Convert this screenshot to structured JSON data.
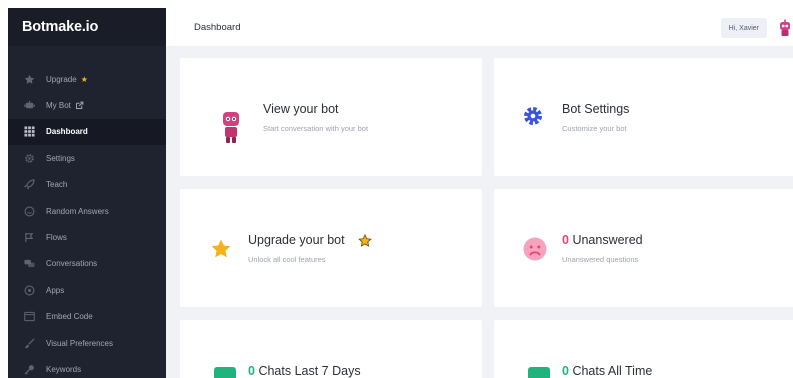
{
  "brand": {
    "name": "Botmake.io"
  },
  "sidebar": {
    "items": [
      {
        "label": "Upgrade",
        "icon": "star-icon"
      },
      {
        "label": "My Bot",
        "icon": "bot-icon"
      },
      {
        "label": "Dashboard",
        "icon": "grid-icon",
        "active": true
      },
      {
        "label": "Settings",
        "icon": "gear-icon"
      },
      {
        "label": "Teach",
        "icon": "rocket-icon"
      },
      {
        "label": "Random Answers",
        "icon": "smiley-icon"
      },
      {
        "label": "Flows",
        "icon": "flows-icon"
      },
      {
        "label": "Conversations",
        "icon": "chat-icon"
      },
      {
        "label": "Apps",
        "icon": "apps-icon"
      },
      {
        "label": "Embed Code",
        "icon": "code-icon"
      },
      {
        "label": "Visual Preferences",
        "icon": "brush-icon"
      },
      {
        "label": "Keywords",
        "icon": "key-icon"
      }
    ]
  },
  "topbar": {
    "title": "Dashboard",
    "greeting": "Hi, Xavier"
  },
  "cards": {
    "view_bot": {
      "title": "View your bot",
      "subtitle": "Start conversation with your bot"
    },
    "bot_settings": {
      "title": "Bot Settings",
      "subtitle": "Customize your bot"
    },
    "upgrade": {
      "title": "Upgrade your bot",
      "subtitle": "Unlock all cool features"
    },
    "unanswered": {
      "count": "0",
      "title": "Unanswered",
      "subtitle": "Unanswered questions"
    },
    "chats_week": {
      "count": "0",
      "title": "Chats Last 7 Days"
    },
    "chats_all": {
      "count": "0",
      "title": "Chats All Time"
    }
  },
  "colors": {
    "accent_pink": "#e5437a",
    "settings_blue": "#3b54e0",
    "star_yellow": "#f5b21b",
    "chat_green": "#1fb37e",
    "sidebar_bg": "#1f2330"
  }
}
